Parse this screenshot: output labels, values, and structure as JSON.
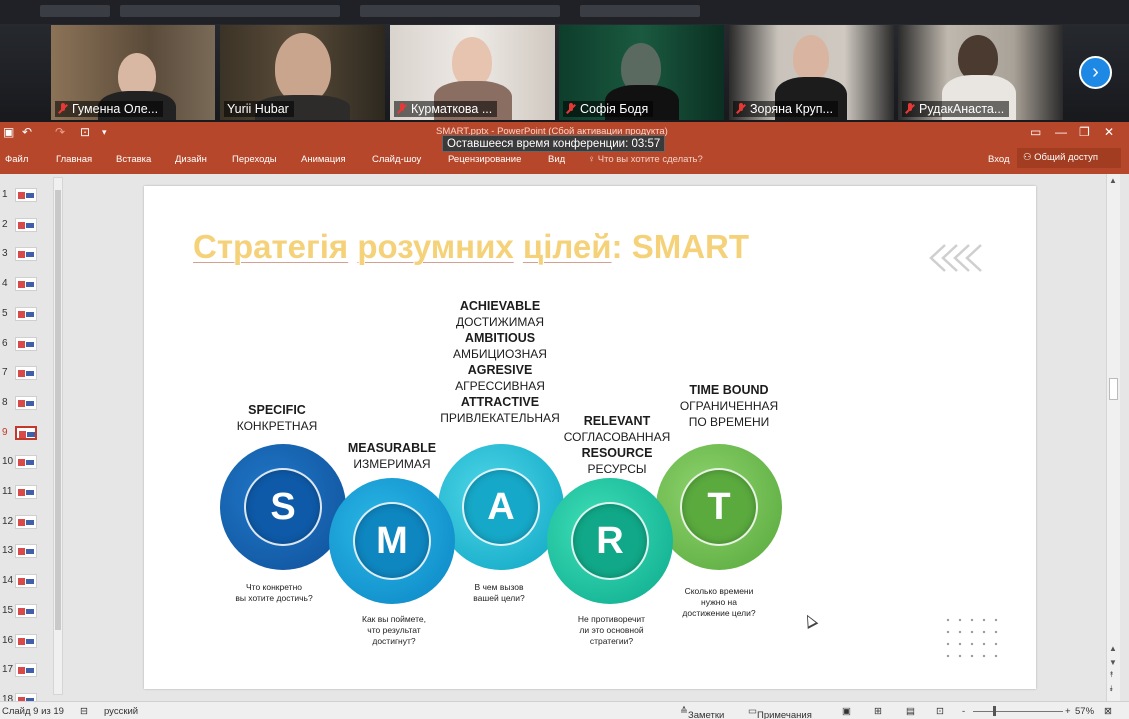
{
  "participants": [
    {
      "name": "Гуменна Оле...",
      "muted": true
    },
    {
      "name": "Yurii Hubar",
      "muted": false
    },
    {
      "name": "Курматкова ...",
      "muted": true
    },
    {
      "name": "Софія Бодя",
      "muted": true
    },
    {
      "name": "Зоряна Круп...",
      "muted": true
    },
    {
      "name": "РудакАнаста...",
      "muted": true
    }
  ],
  "next_participants_icon": "chevron-right-icon",
  "powerpoint": {
    "doc_title": "SMART.pptx - PowerPoint (Сбой активации продукта)",
    "timer": "Оставшееся время конференции: 03:57",
    "quick_access": {
      "save_icon": "save-icon",
      "undo": "↶",
      "redo": "↷",
      "present_icon": "present-icon",
      "customize": "▾"
    },
    "window_controls": {
      "ribbon_display": "▭",
      "minimize": "—",
      "restore": "❐",
      "close": "✕"
    },
    "ribbon_tabs": [
      "Файл",
      "Главная",
      "Вставка",
      "Дизайн",
      "Переходы",
      "Анимация",
      "Слайд-шоу",
      "Рецензирование",
      "Вид"
    ],
    "search_placeholder": "Что вы хотите сделать?",
    "login": "Вход",
    "share": "Общий доступ",
    "thumbnails": [
      "1",
      "2",
      "3",
      "4",
      "5",
      "6",
      "7",
      "8",
      "9",
      "10",
      "11",
      "12",
      "13",
      "14",
      "15",
      "16",
      "17",
      "18"
    ],
    "selected_slide": "9",
    "status": {
      "slide_info": "Слайд 9 из 19",
      "language": "русский",
      "notes": "Заметки",
      "comments": "Примечания",
      "zoom": "57%"
    }
  },
  "slide": {
    "title_part1": "Стратегія",
    "title_part2": "розумних",
    "title_part3": "цілей",
    "title_part4": ": SMART",
    "letters": [
      "S",
      "M",
      "A",
      "R",
      "T"
    ],
    "specific": {
      "en": "SPECIFIC",
      "ru": "КОНКРЕТНАЯ"
    },
    "measurable": {
      "en": "MEASURABLE",
      "ru": "ИЗМЕРИМАЯ"
    },
    "achievable": {
      "en1": "ACHIEVABLE",
      "ru1": "ДОСТИЖИМАЯ",
      "en2": "AMBITIOUS",
      "ru2": "АМБИЦИОЗНАЯ",
      "en3": "AGRESIVE",
      "ru3": "АГРЕССИВНАЯ",
      "en4": "ATTRACTIVE",
      "ru4": "ПРИВЛЕКАТЕЛЬНАЯ"
    },
    "relevant": {
      "en1": "RELEVANT",
      "ru1": "СОГЛАСОВАННАЯ",
      "en2": "RESOURCE",
      "ru2": "РЕСУРСЫ"
    },
    "timebound": {
      "en": "TIME BOUND",
      "ru1": "ОГРАНИЧЕННАЯ",
      "ru2": "ПО ВРЕМЕНИ"
    },
    "questions": {
      "s1": "Что конкретно",
      "s2": "вы хотите достичь?",
      "m1": "Как вы поймете,",
      "m2": "что результат",
      "m3": "достигнут?",
      "a1": "В чем вызов",
      "a2": "вашей цели?",
      "r1": "Не противоречит",
      "r2": "ли это основной",
      "r3": "стратегии?",
      "t1": "Сколько времени",
      "t2": "нужно на",
      "t3": "достижение цели?"
    }
  }
}
